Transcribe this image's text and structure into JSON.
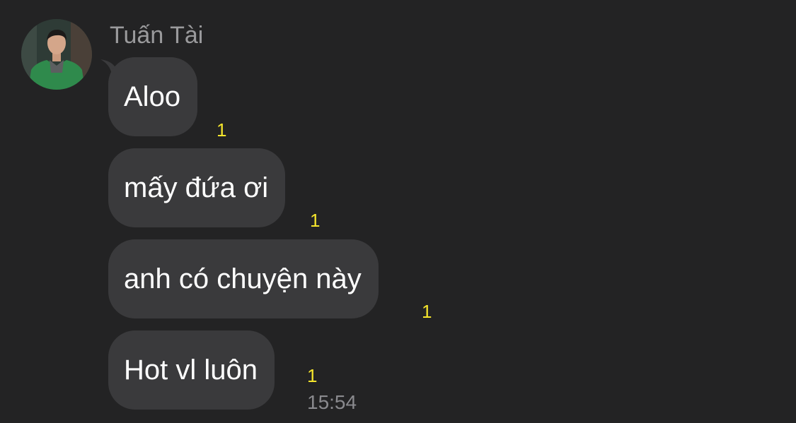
{
  "sender": {
    "name": "Tuấn Tài",
    "avatar_icon": "profile-photo"
  },
  "messages": [
    {
      "text": "Aloo",
      "unread": "1"
    },
    {
      "text": "mấy đứa ơi",
      "unread": "1"
    },
    {
      "text": "anh có chuyện này",
      "unread": "1"
    },
    {
      "text": "Hot vl luôn",
      "unread": "1"
    }
  ],
  "last_time": "15:54",
  "colors": {
    "background": "#232324",
    "bubble": "#3a3a3c",
    "unread": "#f5e52c",
    "name": "#9a9a9c"
  }
}
